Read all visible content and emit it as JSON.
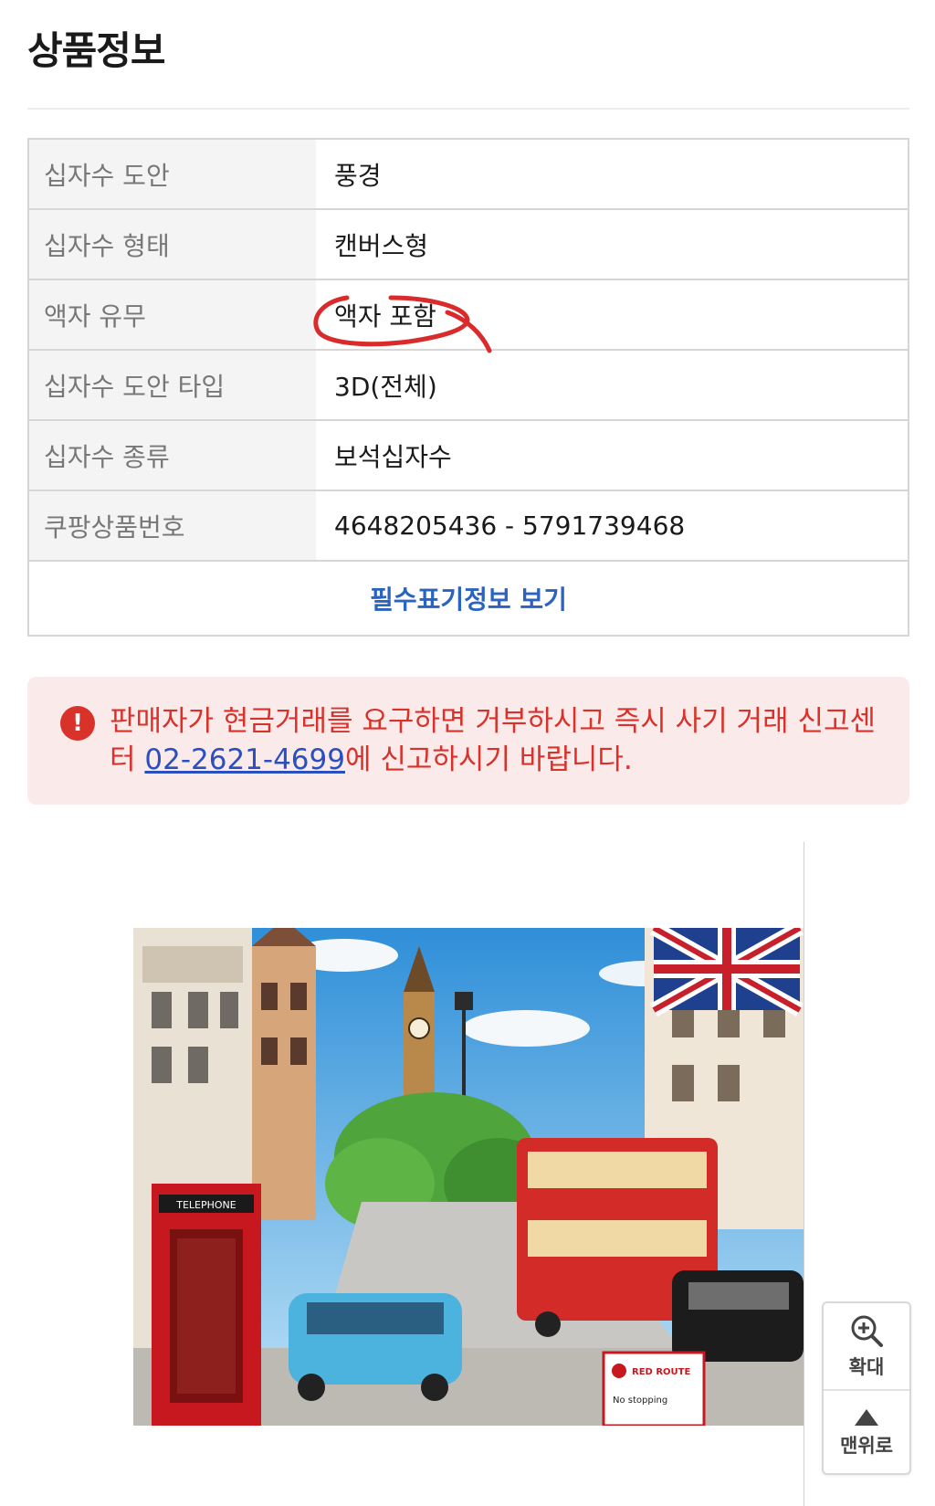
{
  "header": {
    "title": "상품정보"
  },
  "specs": [
    {
      "key": "십자수 도안",
      "value": "풍경"
    },
    {
      "key": "십자수 형태",
      "value": "캔버스형"
    },
    {
      "key": "액자 유무",
      "value": "액자 포함"
    },
    {
      "key": "십자수 도안 타입",
      "value": "3D(전체)"
    },
    {
      "key": "십자수 종류",
      "value": "보석십자수"
    },
    {
      "key": "쿠팡상품번호",
      "value": "4648205436 - 5791739468"
    }
  ],
  "spec_more_label": "필수표기정보 보기",
  "warning": {
    "icon": "!",
    "text_before": "판매자가 현금거래를 요구하면 거부하시고 즉시 사기 거래 신고센터 ",
    "phone": "02-2621-4699",
    "text_after": "에 신고하시기 바랍니다."
  },
  "product_image": {
    "signs": {
      "telephone": "TELEPHONE",
      "red_route": "RED ROUTE",
      "no_stopping": "No stopping"
    }
  },
  "float_buttons": {
    "zoom": "확대",
    "top": "맨위로"
  },
  "colors": {
    "accent_blue": "#2a63c0",
    "warning_red": "#d9322b",
    "warning_bg": "#fbeaea",
    "annotation_red": "#d92b2b"
  },
  "icons": [
    "zoom-in-icon",
    "arrow-up-icon",
    "alert-icon"
  ]
}
